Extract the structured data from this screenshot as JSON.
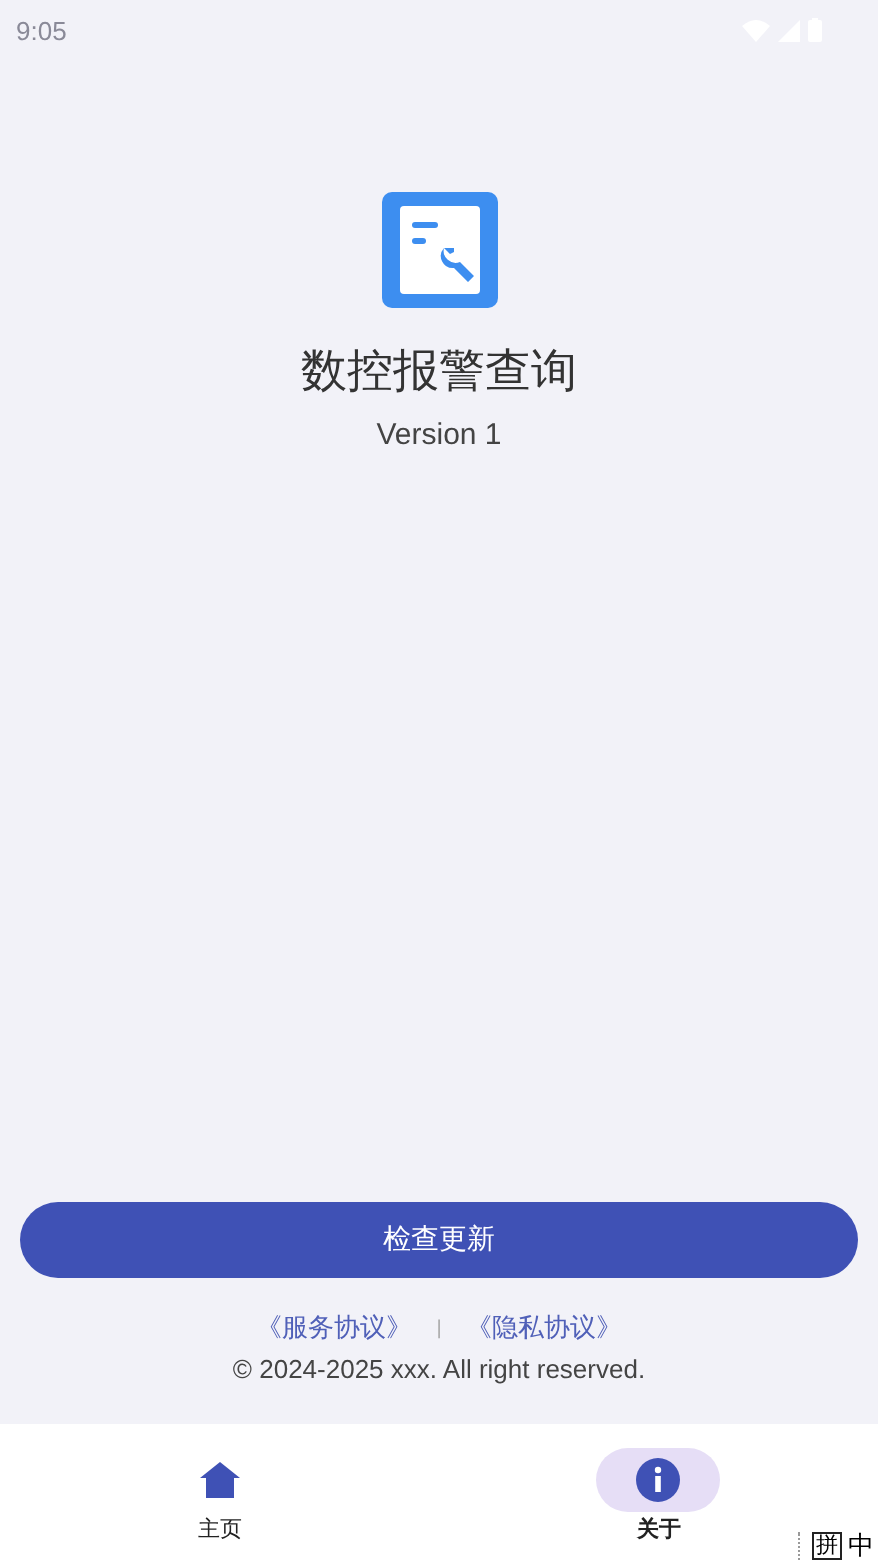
{
  "status_bar": {
    "time": "9:05"
  },
  "app": {
    "title": "数控报警查询",
    "version": "Version 1"
  },
  "update_button": {
    "label": "检查更新"
  },
  "links": [
    {
      "label": "《服务协议》"
    },
    {
      "label": "《隐私协议》"
    }
  ],
  "separator": "|",
  "copyright": "© 2024-2025 xxx. All right reserved.",
  "nav": [
    {
      "label": "主页",
      "kind": "home",
      "selected": false
    },
    {
      "label": "关于",
      "kind": "info",
      "selected": true
    }
  ],
  "ime_indicator": {
    "mode": "拼",
    "language": "中"
  }
}
